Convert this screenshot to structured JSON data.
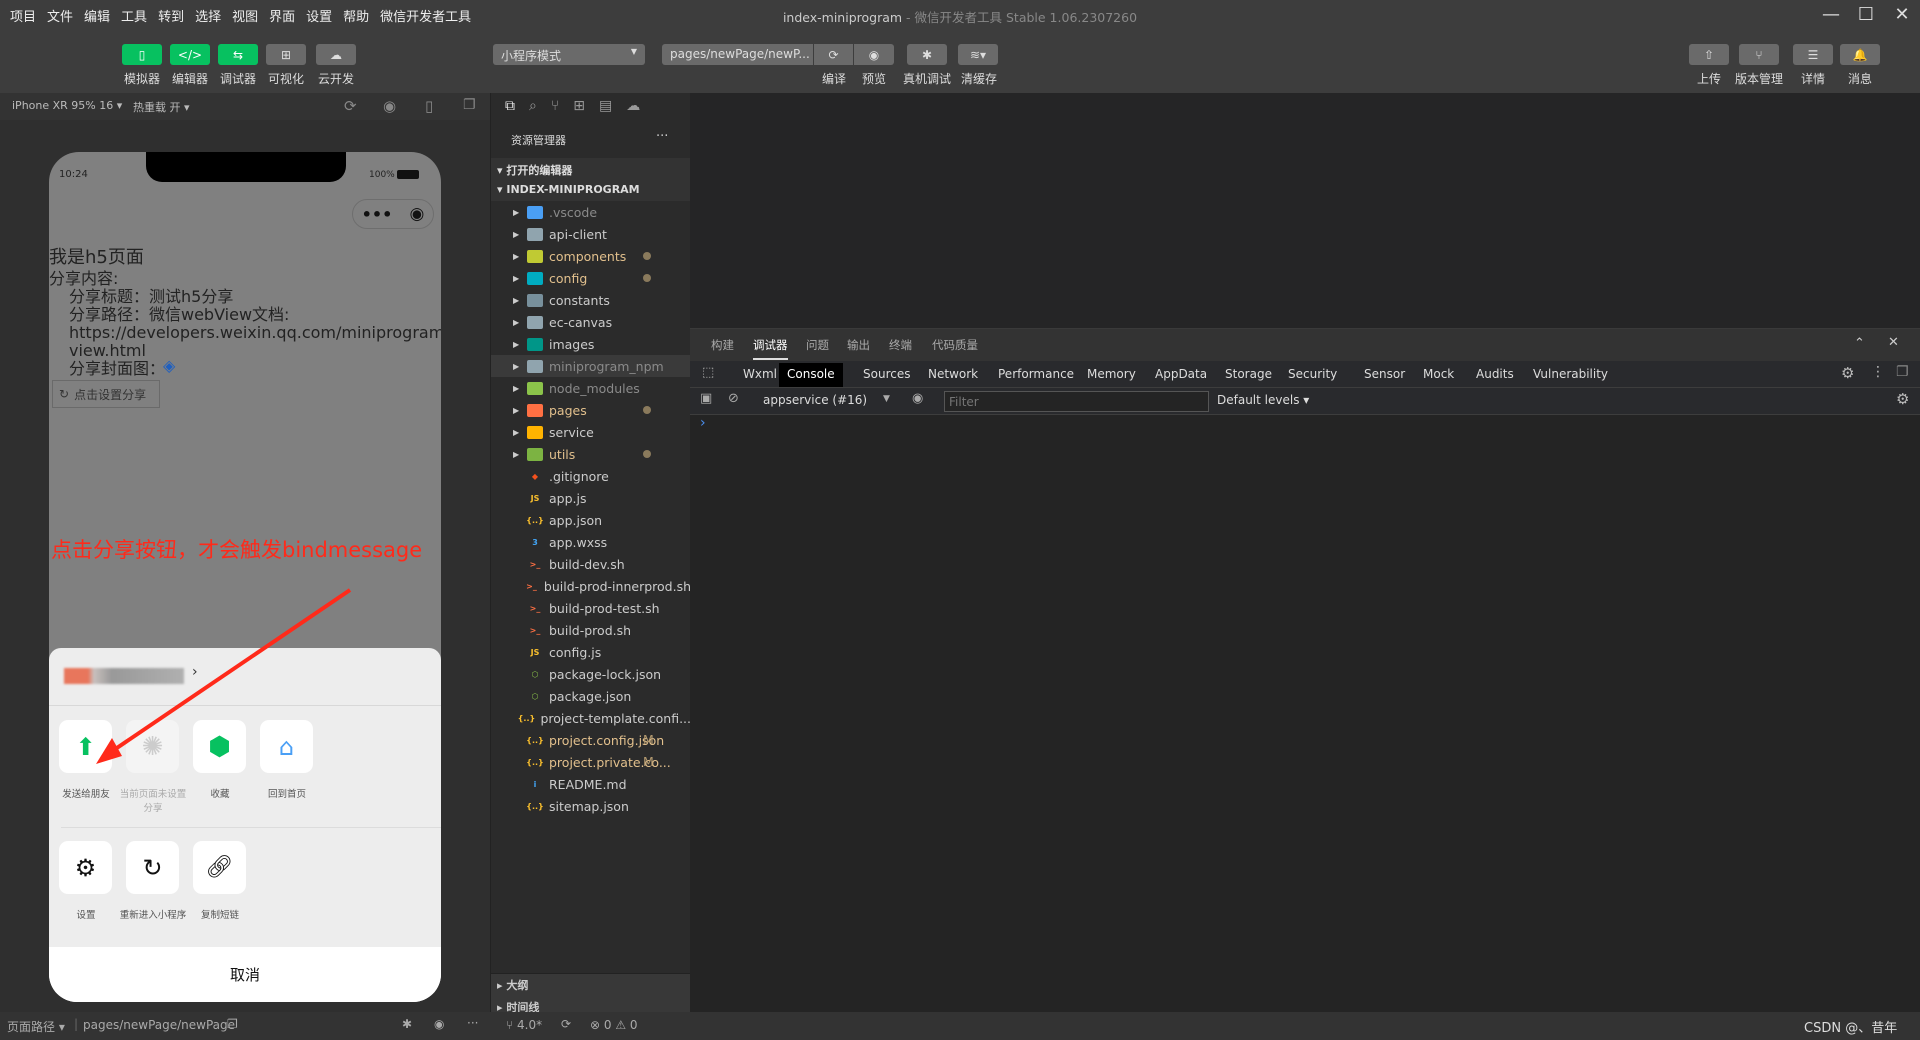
{
  "menu": [
    "项目",
    "文件",
    "编辑",
    "工具",
    "转到",
    "选择",
    "视图",
    "界面",
    "设置",
    "帮助",
    "微信开发者工具"
  ],
  "window": {
    "title": "index-miniprogram",
    "subtitle": " - 微信开发者工具 Stable 1.06.2307260",
    "min": "—",
    "max": "☐",
    "close": "✕"
  },
  "toolbar": {
    "left": [
      {
        "label": "模拟器",
        "icon": "phone-icon",
        "glyph": "▯",
        "green": true
      },
      {
        "label": "编辑器",
        "icon": "code-icon",
        "glyph": "</>",
        "green": true
      },
      {
        "label": "调试器",
        "icon": "debug-swap-icon",
        "glyph": "⇆",
        "green": true
      },
      {
        "label": "可视化",
        "icon": "layout-icon",
        "glyph": "⊞",
        "green": false
      },
      {
        "label": "云开发",
        "icon": "cloud-icon",
        "glyph": "☁",
        "green": false
      }
    ],
    "mode": "小程序模式",
    "page": "pages/newPage/newP...",
    "compile": "编译",
    "preview": "预览",
    "remote_debug": "真机调试",
    "clear_cache": "清缓存",
    "right": [
      {
        "label": "上传",
        "icon": "upload-icon",
        "glyph": "⇧"
      },
      {
        "label": "版本管理",
        "icon": "branch-icon",
        "glyph": "⑂"
      },
      {
        "label": "详情",
        "icon": "menu-icon",
        "glyph": "☰"
      },
      {
        "label": "消息",
        "icon": "bell-icon",
        "glyph": "🔔"
      }
    ]
  },
  "simbar": {
    "device": "iPhone XR 95% 16 ▾",
    "hot_reload": "热重载 开 ▾"
  },
  "phone": {
    "time": "10:24",
    "battery": "100%",
    "title": "我是h5页面",
    "share_content": "分享内容:",
    "share_title": "分享标题：测试h5分享",
    "share_path": "分享路径：微信webView文档:",
    "url1": "https://developers.weixin.qq.com/miniprogram/d",
    "url2": "view.html",
    "cover": "分享封面图：",
    "set_share_button": "点击设置分享",
    "annotation": "点击分享按钮，才会触发bindmessage",
    "annotation_color": "#ff2a1a",
    "sheet": {
      "row1": [
        {
          "label": "发送给朋友",
          "icon": "send-to-friend-icon",
          "disabled": false
        },
        {
          "label": "当前页面未设置分享",
          "icon": "shutter-icon",
          "disabled": true
        },
        {
          "label": "收藏",
          "icon": "cube-icon",
          "disabled": false
        },
        {
          "label": "回到首页",
          "icon": "home-icon",
          "disabled": false
        }
      ],
      "row2": [
        {
          "label": "设置",
          "icon": "gear-icon"
        },
        {
          "label": "重新进入小程序",
          "icon": "reload-icon"
        },
        {
          "label": "复制短链",
          "icon": "link-icon"
        }
      ],
      "cancel": "取消"
    }
  },
  "explorer": {
    "title": "资源管理器",
    "more": "···",
    "open_editors": "打开的编辑器",
    "project": "INDEX-MINIPROGRAM",
    "items": [
      {
        "name": ".vscode",
        "folder": true,
        "color": "#4a9ff5",
        "text": "#8a8a8a"
      },
      {
        "name": "api-client",
        "folder": true,
        "color": "#90a4ae"
      },
      {
        "name": "components",
        "folder": true,
        "color": "#c0ca33",
        "text": "#e2c08d",
        "dot": true
      },
      {
        "name": "config",
        "folder": true,
        "color": "#00acc1",
        "text": "#e2c08d",
        "dot": true
      },
      {
        "name": "constants",
        "folder": true,
        "color": "#78909c"
      },
      {
        "name": "ec-canvas",
        "folder": true,
        "color": "#90a4ae"
      },
      {
        "name": "images",
        "folder": true,
        "color": "#009688"
      },
      {
        "name": "miniprogram_npm",
        "folder": true,
        "color": "#90a4ae",
        "text": "#8a8a8a",
        "selected": true
      },
      {
        "name": "node_modules",
        "folder": true,
        "color": "#8bc34a",
        "text": "#8a8a8a"
      },
      {
        "name": "pages",
        "folder": true,
        "color": "#ff7043",
        "text": "#e2c08d",
        "dot": true
      },
      {
        "name": "service",
        "folder": true,
        "color": "#ffb300"
      },
      {
        "name": "utils",
        "folder": true,
        "color": "#7cb342",
        "text": "#e2c08d",
        "dot": true
      },
      {
        "name": ".gitignore",
        "glyph": "◆",
        "color": "#f4511e"
      },
      {
        "name": "app.js",
        "glyph": "JS",
        "color": "#fbc02d"
      },
      {
        "name": "app.json",
        "glyph": "{..}",
        "color": "#fbc02d"
      },
      {
        "name": "app.wxss",
        "glyph": "3",
        "color": "#42a5f5"
      },
      {
        "name": "build-dev.sh",
        "glyph": ">_",
        "color": "#ff7043"
      },
      {
        "name": "build-prod-innerprod.sh",
        "glyph": ">_",
        "color": "#ff7043"
      },
      {
        "name": "build-prod-test.sh",
        "glyph": ">_",
        "color": "#ff7043"
      },
      {
        "name": "build-prod.sh",
        "glyph": ">_",
        "color": "#ff7043"
      },
      {
        "name": "config.js",
        "glyph": "JS",
        "color": "#fbc02d"
      },
      {
        "name": "package-lock.json",
        "glyph": "⬡",
        "color": "#8bc34a"
      },
      {
        "name": "package.json",
        "glyph": "⬡",
        "color": "#8bc34a"
      },
      {
        "name": "project-template.confi...",
        "glyph": "{..}",
        "color": "#fbc02d"
      },
      {
        "name": "project.config.json",
        "glyph": "{..}",
        "color": "#fbc02d",
        "text": "#e2c08d",
        "badge": "M"
      },
      {
        "name": "project.private.co...",
        "glyph": "{..}",
        "color": "#fbc02d",
        "text": "#e2c08d",
        "badge": "M"
      },
      {
        "name": "README.md",
        "glyph": "i",
        "color": "#42a5f5"
      },
      {
        "name": "sitemap.json",
        "glyph": "{..}",
        "color": "#fbc02d"
      }
    ],
    "outline": "大纲",
    "timeline": "时间线"
  },
  "devtools": {
    "top_tabs": [
      "构建",
      "调试器",
      "问题",
      "输出",
      "终端",
      "代码质量"
    ],
    "active_top": "调试器",
    "tabs": [
      "Wxml",
      "Console",
      "Sources",
      "Network",
      "Performance",
      "Memory",
      "AppData",
      "Storage",
      "Security",
      "Sensor",
      "Mock",
      "Audits",
      "Vulnerability"
    ],
    "active_tab": "Console",
    "context": "appservice (#16)",
    "filter_placeholder": "Filter",
    "levels": "Default levels ▾",
    "prompt": "›"
  },
  "status": {
    "page_path": "页面路径 ▾",
    "path": "pages/newPage/newPage",
    "git": "4.0*",
    "errors": "0",
    "warnings": "0",
    "credit": "CSDN @、昔年"
  }
}
